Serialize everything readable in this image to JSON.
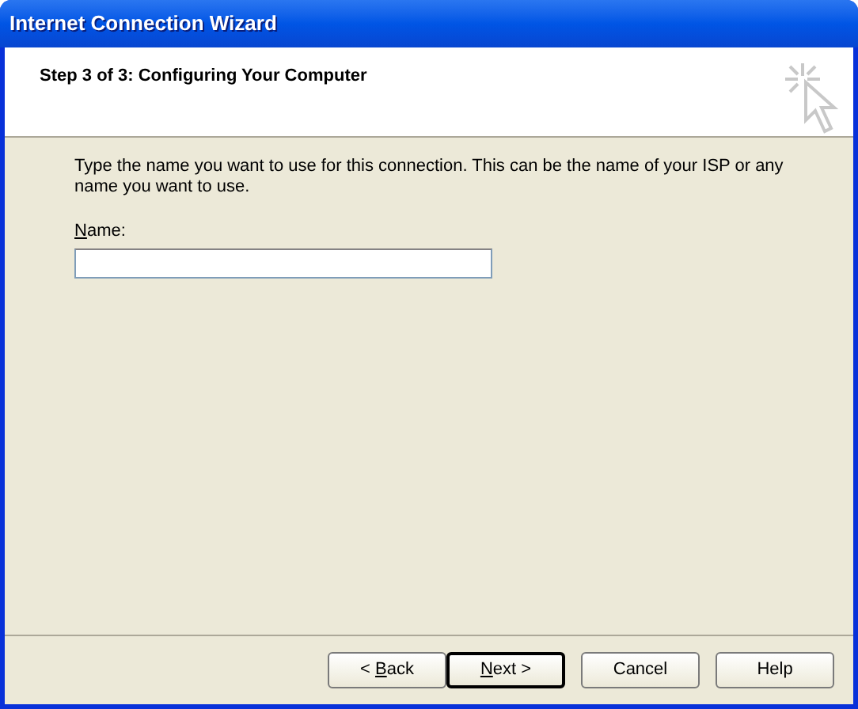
{
  "window": {
    "title": "Internet Connection Wizard"
  },
  "header": {
    "title": "Step 3 of 3: Configuring Your Computer"
  },
  "instructions": "Type the name you want to use for this connection. This can be the name of your ISP or any name you want to use.",
  "name_field": {
    "label": "Name:",
    "access_key_underlined": true
  },
  "buttons": [
    {
      "label": "< Back",
      "access_key_underlined": true,
      "default": false
    },
    {
      "label": "Next >",
      "access_key_underlined": true,
      "default": true
    },
    {
      "label": "Cancel",
      "access_key_underlined": false,
      "default": false
    },
    {
      "label": "Help",
      "access_key_underlined": false,
      "default": false
    }
  ]
}
